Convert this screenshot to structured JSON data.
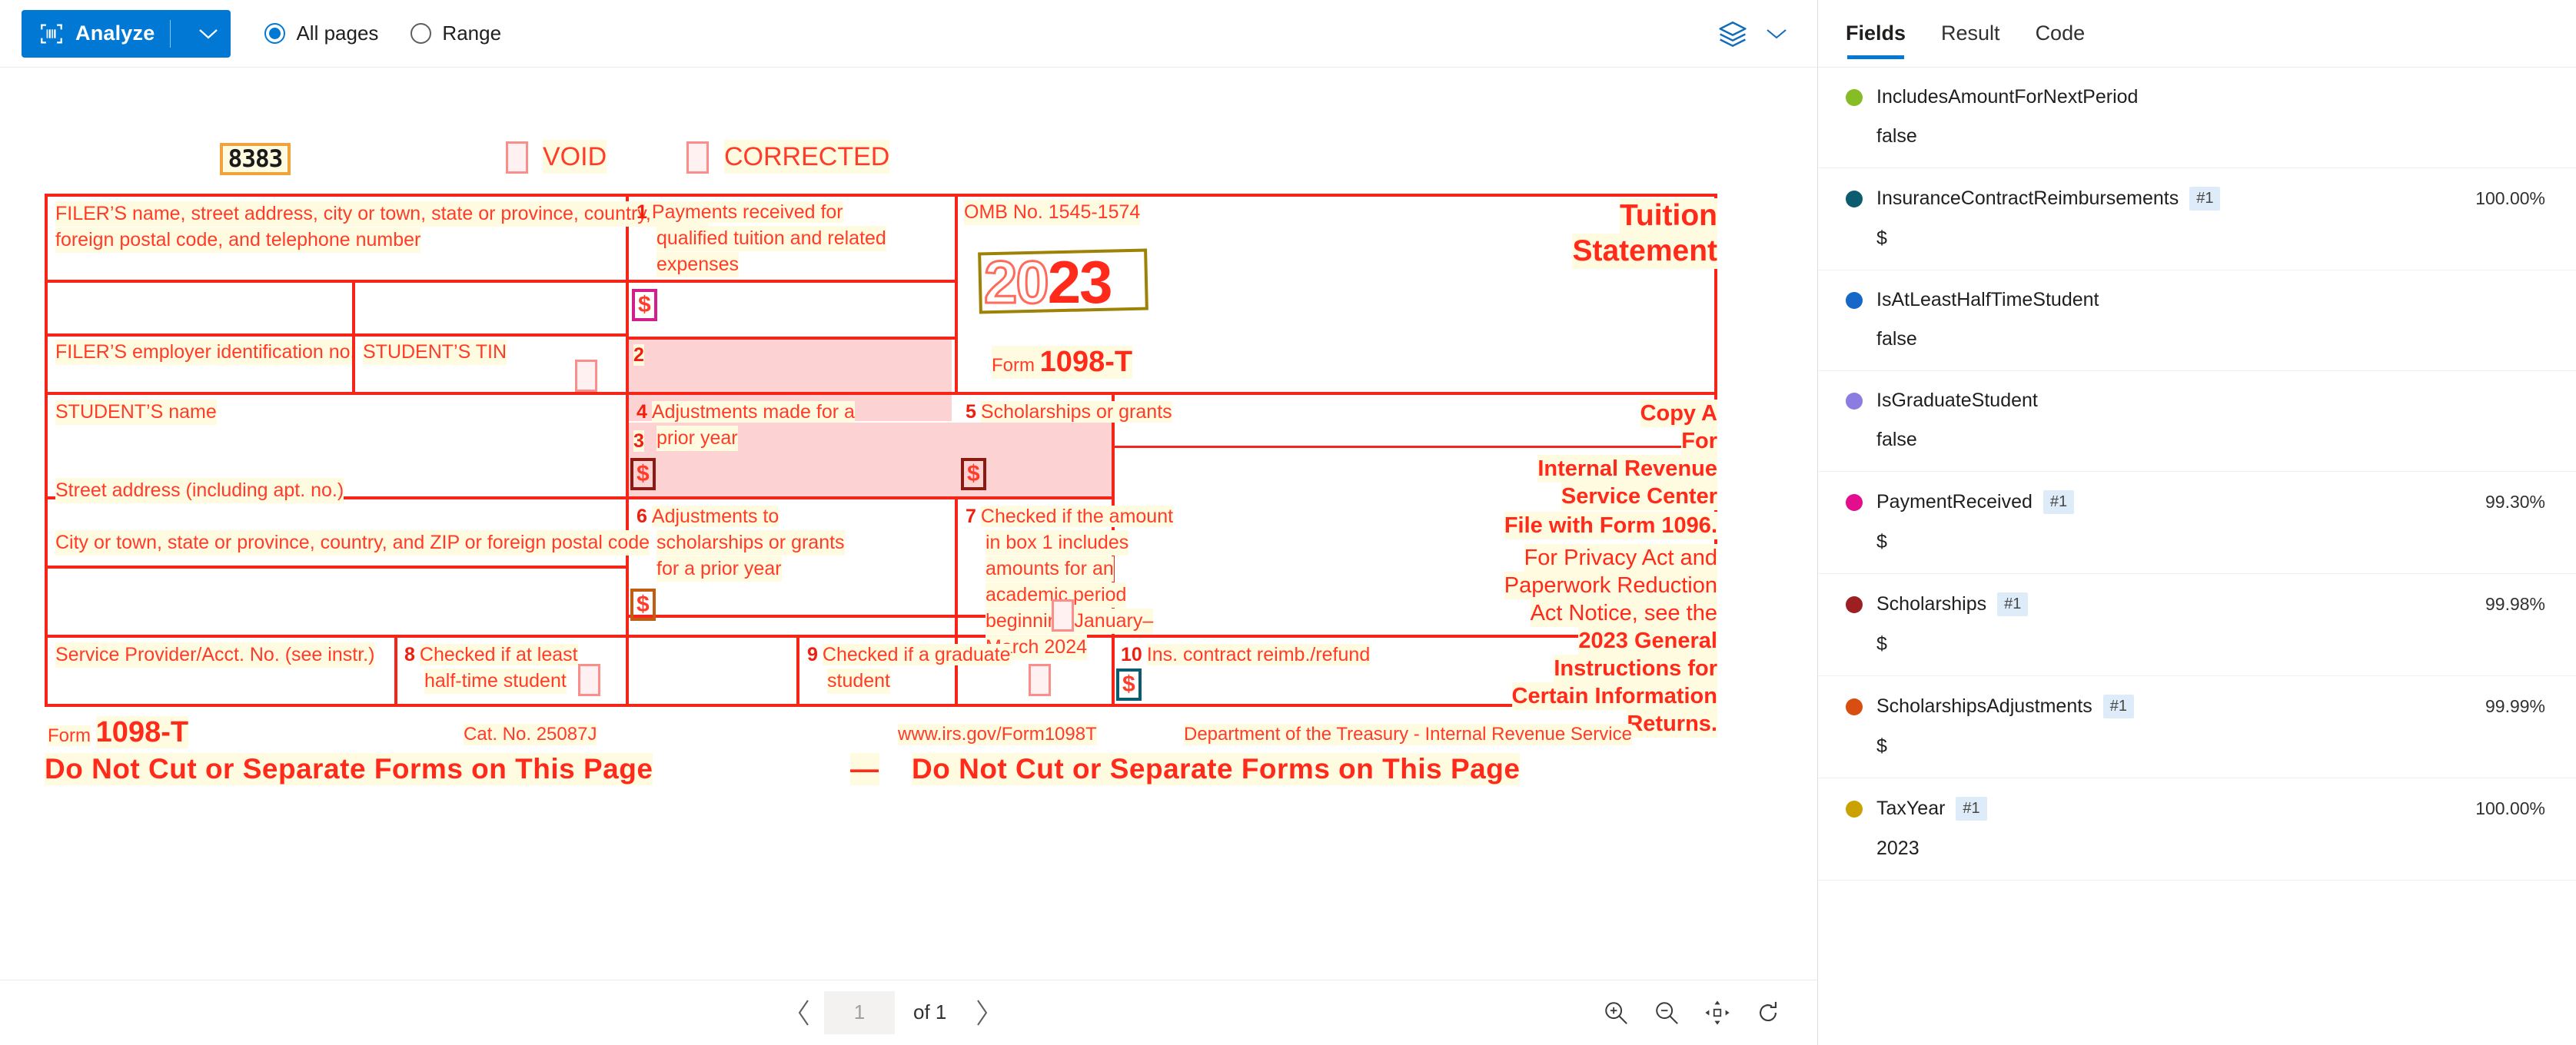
{
  "toolbar": {
    "analyze_label": "Analyze",
    "scan_icon": "scan-icon",
    "caret_icon": "chevron-down-icon",
    "radios": [
      {
        "label": "All pages",
        "selected": true
      },
      {
        "label": "Range",
        "selected": false
      }
    ],
    "layers_icon": "layers-icon",
    "layers_caret_icon": "chevron-down-icon"
  },
  "pagenav": {
    "prev_icon": "chevron-left-icon",
    "next_icon": "chevron-right-icon",
    "page_value": "1",
    "of_label": "of 1",
    "zoom_in_icon": "zoom-in-icon",
    "zoom_out_icon": "zoom-out-icon",
    "fit_page_icon": "fit-to-page-icon",
    "rotate_icon": "rotate-icon"
  },
  "panel": {
    "tabs": [
      {
        "label": "Fields",
        "active": true
      },
      {
        "label": "Result",
        "active": false
      },
      {
        "label": "Code",
        "active": false
      }
    ],
    "fields": [
      {
        "name": "IncludesAmountForNextPeriod",
        "occurrence": "",
        "confidence": "",
        "value": "false",
        "color": "#86bc25"
      },
      {
        "name": "InsuranceContractReimbursements",
        "occurrence": "#1",
        "confidence": "100.00%",
        "value": "$",
        "color": "#0a5c6e"
      },
      {
        "name": "IsAtLeastHalfTimeStudent",
        "occurrence": "",
        "confidence": "",
        "value": "false",
        "color": "#1668c8"
      },
      {
        "name": "IsGraduateStudent",
        "occurrence": "",
        "confidence": "",
        "value": "false",
        "color": "#8a7ce0"
      },
      {
        "name": "PaymentReceived",
        "occurrence": "#1",
        "confidence": "99.30%",
        "value": "$",
        "color": "#e30d8d"
      },
      {
        "name": "Scholarships",
        "occurrence": "#1",
        "confidence": "99.98%",
        "value": "$",
        "color": "#9e1f22"
      },
      {
        "name": "ScholarshipsAdjustments",
        "occurrence": "#1",
        "confidence": "99.99%",
        "value": "$",
        "color": "#d94d10"
      },
      {
        "name": "TaxYear",
        "occurrence": "#1",
        "confidence": "100.00%",
        "value": "2023",
        "color": "#c9a200"
      }
    ]
  },
  "document": {
    "control_number": "8383",
    "void_label": "VOID",
    "corrected_label": "CORRECTED",
    "filer_name_caption_l1": "FILER’S name, street address, city or town, state or province, country, ZIP or",
    "filer_name_caption_l2": "foreign postal code, and telephone number",
    "box1_num": "1",
    "box1_l1": "Payments received for",
    "box1_l2": "qualified tuition and related",
    "box1_l3": "expenses",
    "box2_num": "2",
    "box3_num": "3",
    "omb": "OMB No. 1545-1574",
    "year_prefix": "20",
    "year_suffix": "23",
    "form_label": "Form",
    "form_number": "1098-T",
    "title_l1": "Tuition",
    "title_l2": "Statement",
    "filer_ein_caption": "FILER’S employer identification no.",
    "student_tin_caption": "STUDENT’S TIN",
    "student_name_caption": "STUDENT’S name",
    "street_caption": "Street address (including apt. no.)",
    "city_caption": "City or town, state or province, country, and ZIP or foreign postal code",
    "box4_num": "4",
    "box4_l1": "Adjustments made for a",
    "box4_l2": "prior year",
    "box5_num": "5",
    "box5_l1": "Scholarships or grants",
    "box6_num": "6",
    "box6_l1": "Adjustments to",
    "box6_l2": "scholarships or grants",
    "box6_l3": "for a prior year",
    "box7_num": "7",
    "box7_l1": "Checked if the amount",
    "box7_l2": "in box 1 includes",
    "box7_l3": "amounts for an",
    "box7_l4": "academic period",
    "box7_l5": "beginning January–",
    "box7_l6": "March 2024",
    "svc_caption": "Service Provider/Acct. No. (see instr.)",
    "box8_num": "8",
    "box8_l1": "Checked if at least",
    "box8_l2": "half-time student",
    "box9_num": "9",
    "box9_l1": "Checked if a graduate",
    "box9_l2": "student",
    "box10_num": "10",
    "box10_l1": "Ins. contract reimb./refund",
    "copy_l1": "Copy A",
    "copy_l2": "For",
    "copy_l3": "Internal Revenue",
    "copy_l4": "Service Center",
    "copy_l5": "File with Form 1096.",
    "copy_l6": "For Privacy Act and",
    "copy_l7": "Paperwork Reduction",
    "copy_l8": "Act Notice, see the",
    "copy_l9": "2023 General",
    "copy_l10": "Instructions for",
    "copy_l11": "Certain Information",
    "copy_l12": "Returns.",
    "footer_form_label": "Form",
    "footer_form_number": "1098-T",
    "cat_no": "Cat. No. 25087J",
    "irs_url": "www.irs.gov/Form1098T",
    "treasury": "Department of the Treasury - Internal Revenue Service",
    "donotcut_left": "Do Not Cut or Separate Forms on This Page",
    "donotcut_dash": "—",
    "donotcut_right": "Do Not Cut or Separate Forms on This Page",
    "dollar_sign": "$"
  }
}
